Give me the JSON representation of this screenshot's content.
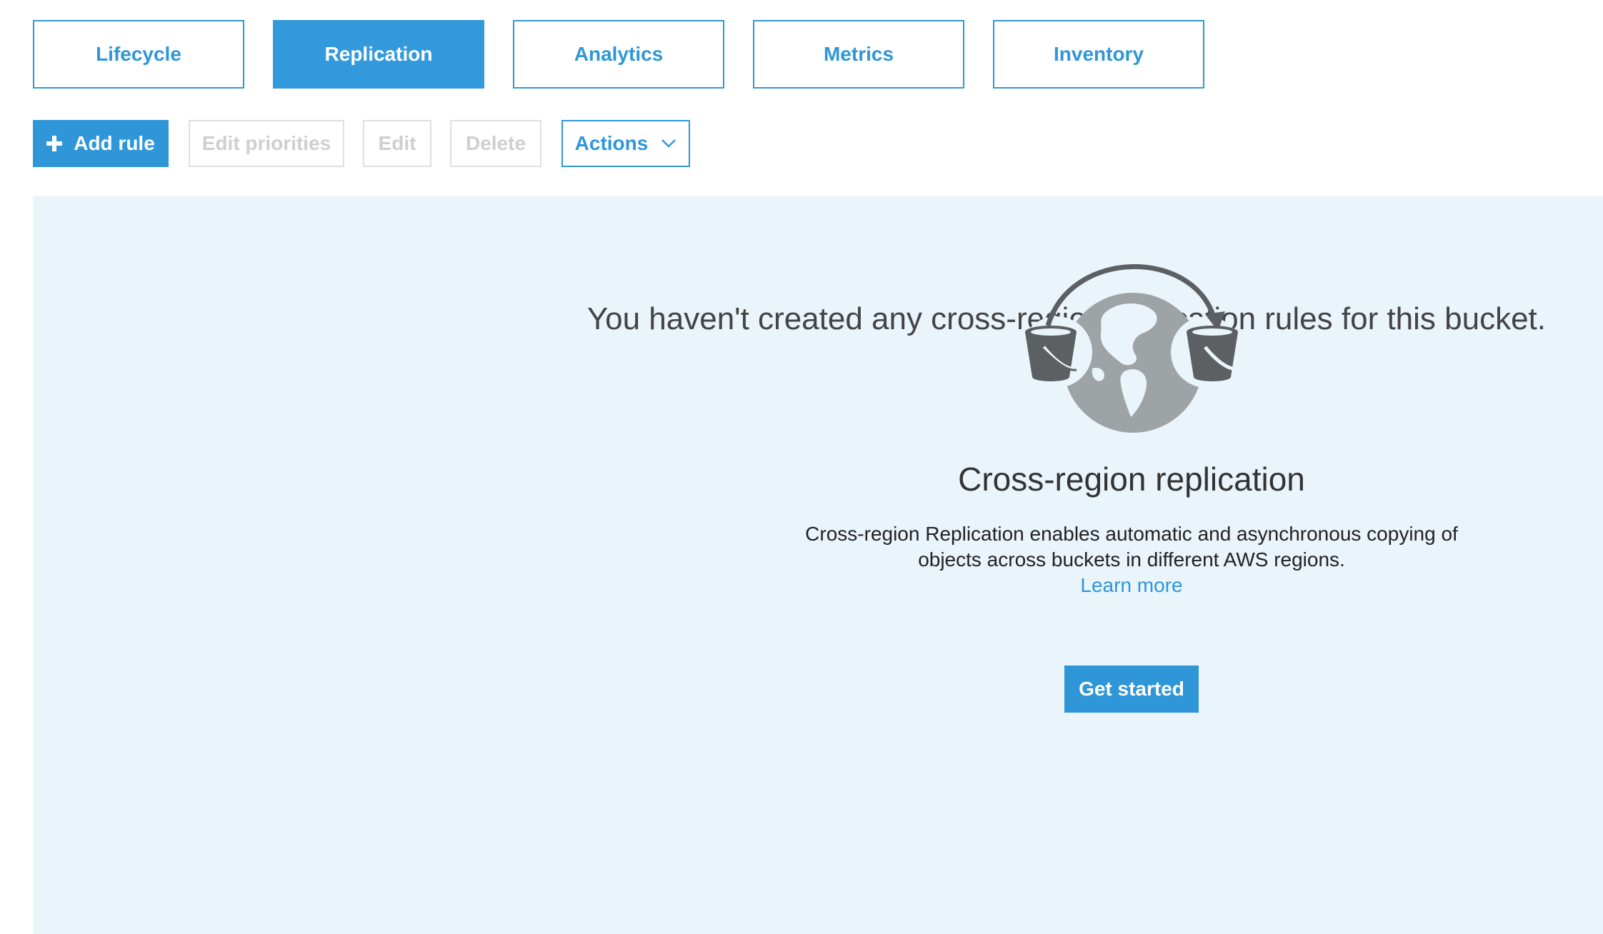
{
  "tabs": [
    {
      "label": "Lifecycle",
      "active": false
    },
    {
      "label": "Replication",
      "active": true
    },
    {
      "label": "Analytics",
      "active": false
    },
    {
      "label": "Metrics",
      "active": false
    },
    {
      "label": "Inventory",
      "active": false
    }
  ],
  "toolbar": {
    "add_rule": "Add rule",
    "edit_priorities": "Edit priorities",
    "edit": "Edit",
    "delete": "Delete",
    "actions": "Actions"
  },
  "empty_state": {
    "message": "You haven't created any cross-region replication rules for this bucket.",
    "feature_title": "Cross-region replication",
    "description_line1": "Cross-region Replication enables automatic and asynchronous copying of",
    "description_line2": "objects across buckets in different AWS regions.",
    "learn_more": "Learn more",
    "get_started": "Get started"
  },
  "colors": {
    "accent": "#2f96d8",
    "panel_bg": "#e9f4fb",
    "disabled_text": "#cfcfcf",
    "illustration_gray": "#9ea3a5",
    "illustration_dark": "#5d6062"
  },
  "icons": [
    "plus-icon",
    "chevron-down-icon",
    "globe-replication-icon",
    "bucket-icon"
  ]
}
